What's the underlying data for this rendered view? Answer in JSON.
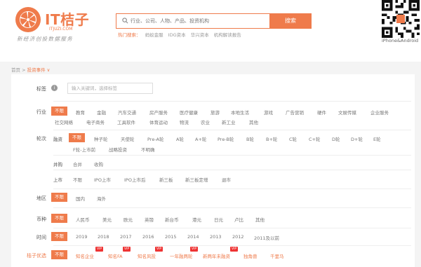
{
  "header": {
    "logo_title": "IT桔子",
    "logo_domain": "ITJUZI.COM",
    "logo_slogan": "新经济创投数据服务",
    "search_placeholder": "行业、公司、人物、产品、投资机构",
    "search_button": "搜索",
    "hot_label": "热门搜索：",
    "hot_items": [
      "蚂蚁金服",
      "IDG资本",
      "华兴资本",
      "机构解读报告"
    ],
    "qr_caption": "iPhone&Android"
  },
  "breadcrumb": {
    "home": "首页",
    "separator": " > ",
    "current": "投资事件 ∨"
  },
  "filters": {
    "tag": {
      "label": "标签",
      "placeholder": "输入关键词，选择标签"
    },
    "industry": {
      "label": "行业",
      "options": [
        "不限",
        "教育",
        "金融",
        "汽车交通",
        "房产服务",
        "医疗健康",
        "旅游",
        "本地生活",
        "游戏",
        "广告营销",
        "硬件",
        "文娱传媒",
        "企业服务",
        "社交网络",
        "电子商务",
        "工具软件",
        "体育运动",
        "物流",
        "农业",
        "新工业",
        "其他"
      ]
    },
    "round": {
      "label": "轮次",
      "sublabel_financing": "融资",
      "financing_options": [
        "不限",
        "种子轮",
        "天使轮",
        "Pre-A轮",
        "A轮",
        "A+轮",
        "Pre-B轮",
        "B轮",
        "B+轮",
        "C轮",
        "C+轮",
        "D轮",
        "D+轮",
        "E轮",
        "F轮-上市前",
        "战略投资",
        "不明确"
      ],
      "sublabel_merger": "并购",
      "merger_options": [
        "合并",
        "收购"
      ],
      "sublabel_ipo": "上市",
      "ipo_options": [
        "不限",
        "IPO上市",
        "IPO上市后",
        "新三板",
        "新三板定增",
        "退市"
      ]
    },
    "region": {
      "label": "地区",
      "options": [
        "不限",
        "国内",
        "海外"
      ]
    },
    "currency": {
      "label": "币种",
      "options": [
        "不限",
        "人民币",
        "美元",
        "欧元",
        "英镑",
        "新台币",
        "港元",
        "日元",
        "卢比",
        "其他"
      ]
    },
    "time": {
      "label": "时间",
      "options": [
        "不限",
        "2019",
        "2018",
        "2017",
        "2016",
        "2015",
        "2014",
        "2013",
        "2012",
        "2011及以前"
      ]
    },
    "premium": {
      "label": "桔子优选",
      "options": [
        "不限",
        "知名企业",
        "知名FA",
        "知名风投",
        "一年融两轮",
        "新两年未融资",
        "独角兽",
        "千里马"
      ],
      "vip": "VIP"
    }
  }
}
